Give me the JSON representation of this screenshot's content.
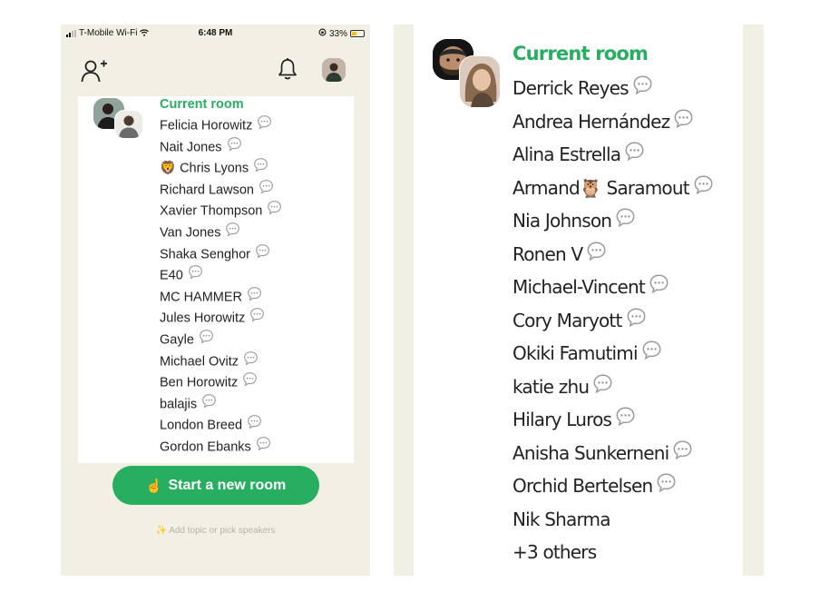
{
  "status_bar": {
    "carrier": "T-Mobile Wi-Fi",
    "time": "6:48 PM",
    "battery": "33%"
  },
  "left_panel": {
    "heading": "Current room",
    "members": [
      {
        "name": "Felicia Horowitz",
        "has_chat": true
      },
      {
        "name": "Nait Jones",
        "has_chat": true
      },
      {
        "name": "🦁 Chris Lyons",
        "has_chat": true
      },
      {
        "name": "Richard Lawson",
        "has_chat": true
      },
      {
        "name": "Xavier Thompson",
        "has_chat": true
      },
      {
        "name": "Van Jones",
        "has_chat": true
      },
      {
        "name": "Shaka Senghor",
        "has_chat": true
      },
      {
        "name": "E40",
        "has_chat": true
      },
      {
        "name": "MC HAMMER",
        "has_chat": true
      },
      {
        "name": "Jules Horowitz",
        "has_chat": true
      },
      {
        "name": "Gayle",
        "has_chat": true
      },
      {
        "name": "Michael Ovitz",
        "has_chat": true
      },
      {
        "name": "Ben Horowitz",
        "has_chat": true
      },
      {
        "name": "balajis",
        "has_chat": true
      },
      {
        "name": "London Breed",
        "has_chat": true
      },
      {
        "name": "Gordon Ebanks",
        "has_chat": true
      }
    ],
    "start_room_label": "Start a new room",
    "start_room_emoji": "☝️",
    "add_topic_hint": "✨ Add topic or pick speakers"
  },
  "right_panel": {
    "heading": "Current room",
    "members": [
      {
        "name": "Derrick Reyes",
        "has_chat": true
      },
      {
        "name": "Andrea Hernández",
        "has_chat": true
      },
      {
        "name": "Alina Estrella",
        "has_chat": true
      },
      {
        "name": "Armand🦉 Saramout",
        "has_chat": true
      },
      {
        "name": "Nia Johnson",
        "has_chat": true
      },
      {
        "name": "Ronen V",
        "has_chat": true
      },
      {
        "name": "Michael-Vincent",
        "has_chat": true
      },
      {
        "name": "Cory Maryott",
        "has_chat": true
      },
      {
        "name": "Okiki Famutimi",
        "has_chat": true
      },
      {
        "name": "katie zhu",
        "has_chat": true
      },
      {
        "name": "Hilary Luros",
        "has_chat": true
      },
      {
        "name": "Anisha Sunkerneni",
        "has_chat": true
      },
      {
        "name": "Orchid Bertelsen",
        "has_chat": true
      },
      {
        "name": "Nik Sharma",
        "has_chat": false
      },
      {
        "name": "+3 others",
        "has_chat": false
      }
    ]
  },
  "colors": {
    "accent_green": "#27ae60",
    "background": "#f2efe4",
    "card": "#ffffff"
  },
  "icons": [
    "add-user-icon",
    "bell-icon",
    "chat-bubble-icon",
    "wifi-icon",
    "battery-icon"
  ]
}
